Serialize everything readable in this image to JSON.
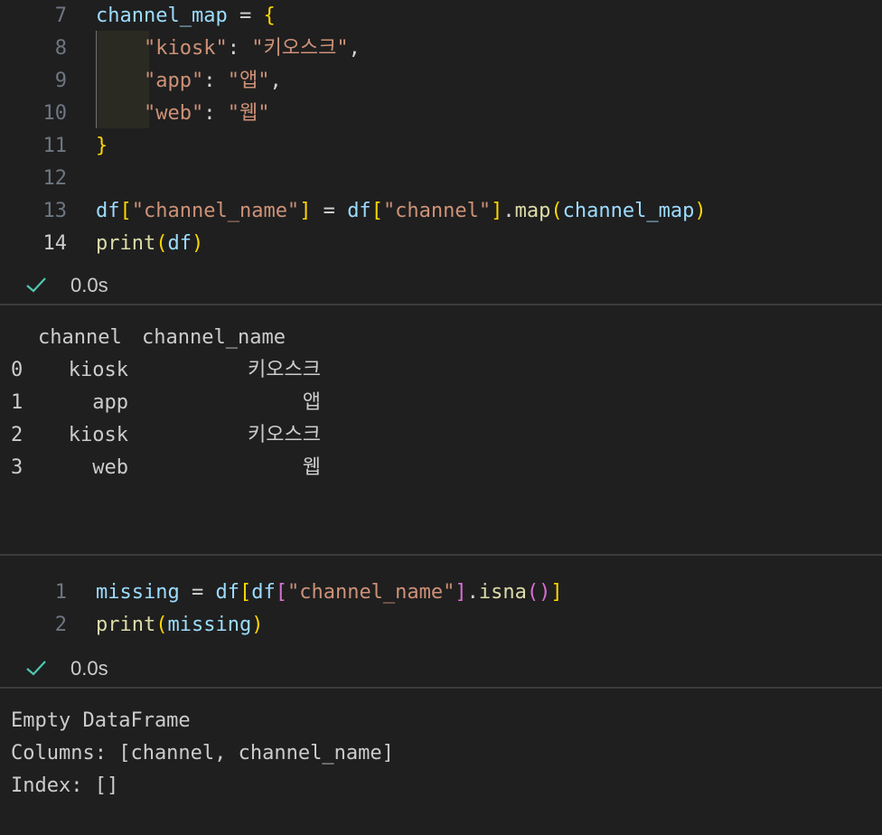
{
  "cell1": {
    "lines": [
      {
        "num": "7",
        "active": false,
        "tokens": [
          {
            "t": "channel_map",
            "c": "var"
          },
          {
            "t": " = ",
            "c": "op"
          },
          {
            "t": "{",
            "c": "b1"
          }
        ]
      },
      {
        "num": "8",
        "active": false,
        "tokens": [
          {
            "t": "    ",
            "c": "op"
          },
          {
            "t": "\"kiosk\"",
            "c": "str"
          },
          {
            "t": ": ",
            "c": "op"
          },
          {
            "t": "\"키오스크\"",
            "c": "str"
          },
          {
            "t": ",",
            "c": "op"
          }
        ]
      },
      {
        "num": "9",
        "active": false,
        "tokens": [
          {
            "t": "    ",
            "c": "op"
          },
          {
            "t": "\"app\"",
            "c": "str"
          },
          {
            "t": ": ",
            "c": "op"
          },
          {
            "t": "\"앱\"",
            "c": "str"
          },
          {
            "t": ",",
            "c": "op"
          }
        ]
      },
      {
        "num": "10",
        "active": false,
        "tokens": [
          {
            "t": "    ",
            "c": "op"
          },
          {
            "t": "\"web\"",
            "c": "str"
          },
          {
            "t": ": ",
            "c": "op"
          },
          {
            "t": "\"웹\"",
            "c": "str"
          }
        ]
      },
      {
        "num": "11",
        "active": false,
        "tokens": [
          {
            "t": "}",
            "c": "b1"
          }
        ]
      },
      {
        "num": "12",
        "active": false,
        "tokens": []
      },
      {
        "num": "13",
        "active": false,
        "tokens": [
          {
            "t": "df",
            "c": "var"
          },
          {
            "t": "[",
            "c": "b1"
          },
          {
            "t": "\"channel_name\"",
            "c": "str"
          },
          {
            "t": "]",
            "c": "b1"
          },
          {
            "t": " = ",
            "c": "op"
          },
          {
            "t": "df",
            "c": "var"
          },
          {
            "t": "[",
            "c": "b1"
          },
          {
            "t": "\"channel\"",
            "c": "str"
          },
          {
            "t": "]",
            "c": "b1"
          },
          {
            "t": ".",
            "c": "op"
          },
          {
            "t": "map",
            "c": "fn"
          },
          {
            "t": "(",
            "c": "b1"
          },
          {
            "t": "channel_map",
            "c": "var"
          },
          {
            "t": ")",
            "c": "b1"
          }
        ]
      },
      {
        "num": "14",
        "active": true,
        "tokens": [
          {
            "t": "print",
            "c": "fn"
          },
          {
            "t": "(",
            "c": "b1"
          },
          {
            "t": "df",
            "c": "var"
          },
          {
            "t": ")",
            "c": "b1"
          }
        ]
      }
    ],
    "status": {
      "icon": "check-icon",
      "time": "0.0s"
    },
    "output": {
      "header": [
        "channel",
        "channel_name"
      ],
      "rows": [
        {
          "index": "0",
          "channel": "kiosk",
          "channel_name": "키오스크"
        },
        {
          "index": "1",
          "channel": "app",
          "channel_name": "앱"
        },
        {
          "index": "2",
          "channel": "kiosk",
          "channel_name": "키오스크"
        },
        {
          "index": "3",
          "channel": "web",
          "channel_name": "웹"
        }
      ]
    }
  },
  "cell2": {
    "lines": [
      {
        "num": "1",
        "active": false,
        "tokens": [
          {
            "t": "missing",
            "c": "var"
          },
          {
            "t": " = ",
            "c": "op"
          },
          {
            "t": "df",
            "c": "var"
          },
          {
            "t": "[",
            "c": "b1"
          },
          {
            "t": "df",
            "c": "var"
          },
          {
            "t": "[",
            "c": "b2"
          },
          {
            "t": "\"channel_name\"",
            "c": "str"
          },
          {
            "t": "]",
            "c": "b2"
          },
          {
            "t": ".",
            "c": "op"
          },
          {
            "t": "isna",
            "c": "fn"
          },
          {
            "t": "()",
            "c": "b2"
          },
          {
            "t": "]",
            "c": "b1"
          }
        ]
      },
      {
        "num": "2",
        "active": false,
        "tokens": [
          {
            "t": "print",
            "c": "fn"
          },
          {
            "t": "(",
            "c": "b1"
          },
          {
            "t": "missing",
            "c": "var"
          },
          {
            "t": ")",
            "c": "b1"
          }
        ]
      }
    ],
    "status": {
      "icon": "check-icon",
      "time": "0.0s"
    },
    "output": {
      "lines": [
        "Empty DataFrame",
        "Columns: [channel, channel_name]",
        "Index: []"
      ]
    }
  },
  "colors": {
    "background": "#1f1f1f",
    "success": "#4ec9b0",
    "string": "#ce9178",
    "variable": "#9cdcfe",
    "function": "#dcdcaa",
    "bracket": "#ffd700"
  }
}
